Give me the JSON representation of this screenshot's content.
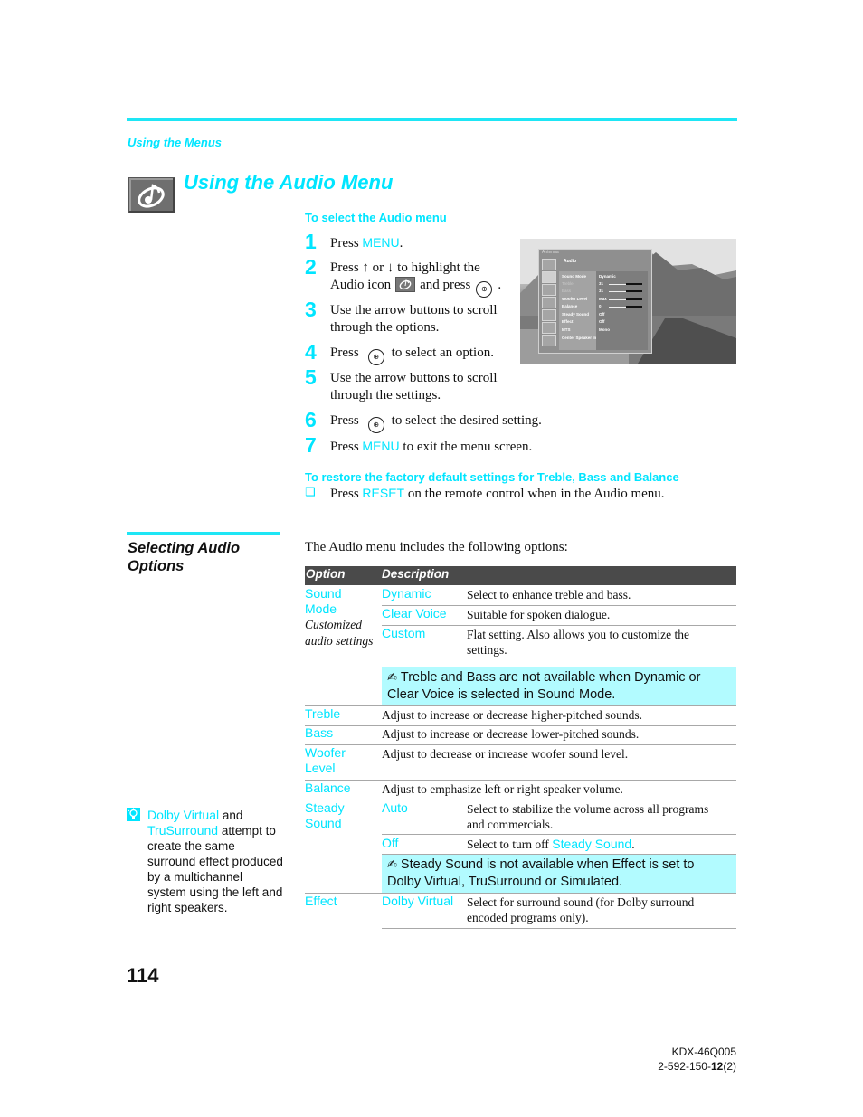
{
  "header": {
    "breadcrumb": "Using the Menus",
    "title": "Using the Audio Menu",
    "title_icon": "audio-note-icon"
  },
  "select_audio_menu": {
    "heading": "To select the Audio menu",
    "steps": [
      {
        "num": "1",
        "pre": "Press ",
        "kw": "MENU",
        "post": "."
      },
      {
        "num": "2",
        "text_a": "Press ",
        "up": "↑",
        "or": " or ",
        "down": "↓",
        "text_b": " to highlight the",
        "text_c": "Audio icon",
        "text_d": "and press",
        "text_e": "."
      },
      {
        "num": "3",
        "text": "Use the arrow buttons to scroll through the options."
      },
      {
        "num": "4",
        "pre": "Press",
        "post": "to select an option."
      },
      {
        "num": "5",
        "text": "Use the arrow buttons to scroll through the settings."
      },
      {
        "num": "6",
        "pre": "Press",
        "post": "to select the desired setting."
      },
      {
        "num": "7",
        "pre": "Press ",
        "kw": "MENU",
        "post": " to exit the menu screen."
      }
    ],
    "enter_button_glyph": "⊕"
  },
  "tv_screen": {
    "menu_title": "Antenna",
    "section": "Audio",
    "rows": [
      {
        "label": "Sound Mode",
        "value": "Dynamic",
        "dim": false
      },
      {
        "label": "Treble",
        "value": "31",
        "dim": true,
        "slider": 0.5
      },
      {
        "label": "Bass",
        "value": "31",
        "dim": true,
        "slider": 0.5
      },
      {
        "label": "Woofer Level",
        "value": "Max",
        "dim": false,
        "slider": 0.5
      },
      {
        "label": "Balance",
        "value": "0",
        "dim": false,
        "slider": 0.5
      },
      {
        "label": "Steady Sound",
        "value": "Off",
        "dim": false
      },
      {
        "label": "Effect",
        "value": "Off",
        "dim": false
      },
      {
        "label": "MTS",
        "value": "Mono",
        "dim": false
      },
      {
        "label": "Center Speaker In",
        "value": "",
        "dim": false
      }
    ]
  },
  "reset": {
    "heading": "To restore the factory default settings for Treble, Bass and Balance",
    "bullet": "❑",
    "pre": "Press ",
    "kw": "RESET",
    "post": " on the remote control when in the Audio menu."
  },
  "section": {
    "title": "Selecting Audio Options",
    "intro": "The Audio menu includes the following options:"
  },
  "table": {
    "headers": {
      "option": "Option",
      "description": "Description"
    },
    "sound_mode": {
      "option": "Sound Mode",
      "italic": "Customized audio settings",
      "subs": [
        {
          "name": "Dynamic",
          "desc": "Select to enhance treble and bass."
        },
        {
          "name": "Clear Voice",
          "desc": "Suitable for spoken dialogue."
        },
        {
          "name": "Custom",
          "desc": "Flat setting. Also allows you to customize the settings."
        }
      ],
      "note": "Treble and Bass are not available when Dynamic or Clear Voice is selected in Sound Mode."
    },
    "simple_rows": [
      {
        "option": "Treble",
        "desc": "Adjust to increase or decrease higher-pitched sounds."
      },
      {
        "option": "Bass",
        "desc": "Adjust to increase or decrease lower-pitched sounds."
      },
      {
        "option": "Woofer Level",
        "desc": "Adjust to decrease or increase woofer sound level."
      },
      {
        "option": "Balance",
        "desc": "Adjust to emphasize left or right speaker volume."
      }
    ],
    "steady_sound": {
      "option": "Steady Sound",
      "subs": [
        {
          "name": "Auto",
          "desc": "Select to stabilize the volume across all programs and commercials."
        },
        {
          "name": "Off",
          "desc_pre": "Select to turn off ",
          "desc_kw": "Steady Sound",
          "desc_post": "."
        }
      ],
      "note": "Steady Sound is not available when Effect is set to Dolby Virtual, TruSurround or Simulated."
    },
    "effect": {
      "option": "Effect",
      "subs": [
        {
          "name": "Dolby Virtual",
          "desc": "Select for surround sound (for Dolby surround encoded programs only)."
        }
      ]
    },
    "note_icon": "✍"
  },
  "tip": {
    "icon": "lightbulb-icon",
    "kw1": "Dolby Virtual",
    "and": " and ",
    "kw2": "TruSurround",
    "rest": " attempt to create the same surround effect produced by a multichannel system using the left and right speakers."
  },
  "footer": {
    "page_number": "114",
    "model": "KDX-46Q005",
    "code_pre": "2-592-150-",
    "code_bold": "12",
    "code_post": "(2)"
  },
  "colors": {
    "accent": "#00e5ff",
    "note_bg": "#b2fbff",
    "table_header_bg": "#4a4a4a"
  }
}
